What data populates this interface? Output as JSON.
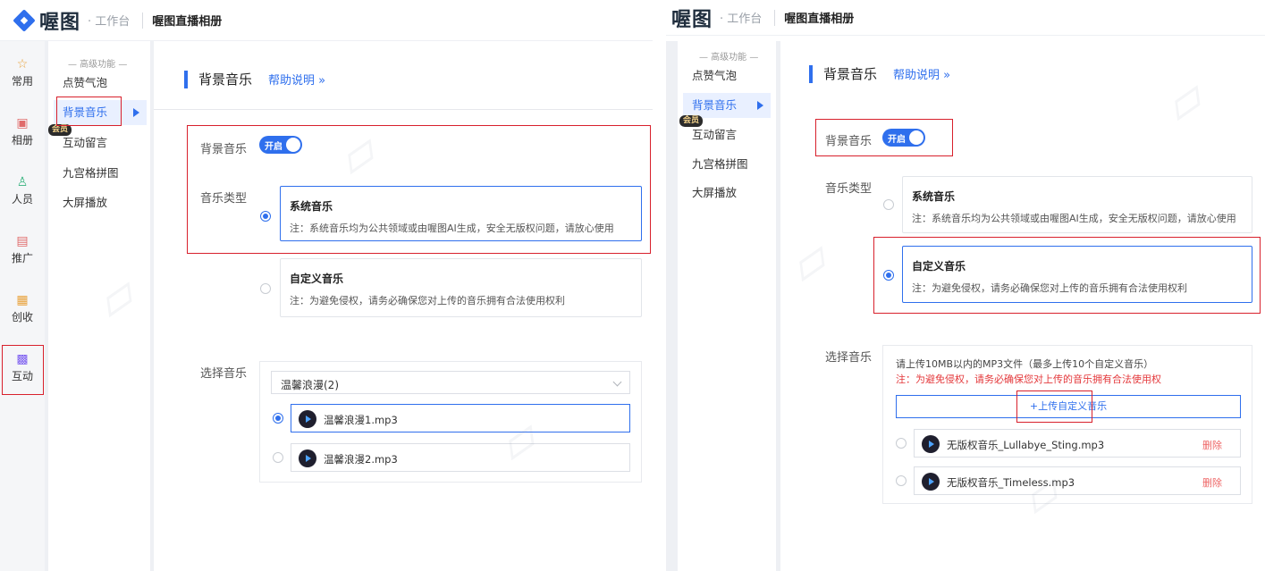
{
  "left": {
    "header": {
      "logo": "喔图",
      "workbench": "· 工作台",
      "album": "喔图直播相册"
    },
    "icon_sidebar": [
      {
        "label": "常用",
        "icon": "star-icon"
      },
      {
        "label": "相册",
        "icon": "album-icon"
      },
      {
        "label": "人员",
        "icon": "person-icon"
      },
      {
        "label": "推广",
        "icon": "promote-icon"
      },
      {
        "label": "创收",
        "icon": "revenue-icon"
      },
      {
        "label": "互动",
        "icon": "interact-icon"
      }
    ],
    "submenu": {
      "heading": "— 高级功能 —",
      "items": [
        "点赞气泡",
        "背景音乐",
        "互动留言",
        "九宫格拼图",
        "大屏播放"
      ],
      "vip": "会员"
    },
    "main": {
      "title": "背景音乐",
      "help": "帮助说明 »",
      "bgm_label": "背景音乐",
      "toggle_text": "开启",
      "type_label": "音乐类型",
      "types": [
        {
          "title": "系统音乐",
          "note": "注：系统音乐均为公共领域或由喔图AI生成，安全无版权问题，请放心使用"
        },
        {
          "title": "自定义音乐",
          "note": "注：为避免侵权，请务必确保您对上传的音乐拥有合法使用权利"
        }
      ],
      "select_label": "选择音乐",
      "dropdown_value": "温馨浪漫(2)",
      "tracks": [
        "温馨浪漫1.mp3",
        "温馨浪漫2.mp3"
      ]
    }
  },
  "right": {
    "header": {
      "logo": "喔图",
      "workbench": "· 工作台",
      "album": "喔图直播相册"
    },
    "submenu": {
      "heading": "— 高级功能 —",
      "items": [
        "点赞气泡",
        "背景音乐",
        "互动留言",
        "九宫格拼图",
        "大屏播放"
      ],
      "vip": "会员"
    },
    "main": {
      "title": "背景音乐",
      "help": "帮助说明 »",
      "bgm_label": "背景音乐",
      "toggle_text": "开启",
      "type_label": "音乐类型",
      "types": [
        {
          "title": "系统音乐",
          "note": "注：系统音乐均为公共领域或由喔图AI生成，安全无版权问题，请放心使用"
        },
        {
          "title": "自定义音乐",
          "note": "注：为避免侵权，请务必确保您对上传的音乐拥有合法使用权利"
        }
      ],
      "select_label": "选择音乐",
      "upload_hint": "请上传10MB以内的MP3文件（最多上传10个自定义音乐）",
      "upload_warn": "注：为避免侵权，请务必确保您对上传的音乐拥有合法使用权",
      "upload_button": "+上传自定义音乐",
      "tracks": [
        {
          "name": "无版权音乐_Lullabye_Sting.mp3",
          "delete": "删除"
        },
        {
          "name": "无版权音乐_Timeless.mp3",
          "delete": "删除"
        }
      ]
    }
  },
  "colors": {
    "accent": "#2f6fed",
    "highlight": "#d8202c",
    "danger": "#e4393c"
  }
}
